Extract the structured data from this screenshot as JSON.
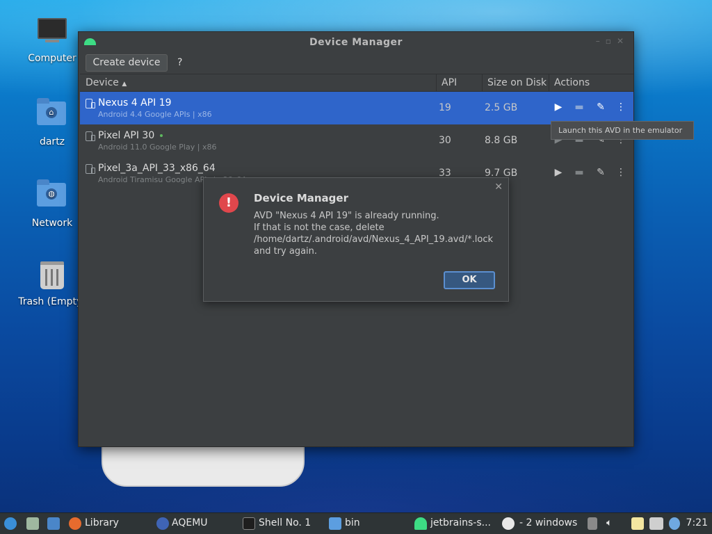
{
  "desktop": {
    "icons": [
      {
        "label": "Computer"
      },
      {
        "label": "dartz"
      },
      {
        "label": "Network"
      },
      {
        "label": "Trash (Empty)"
      }
    ]
  },
  "window": {
    "title": "Device Manager",
    "toolbar": {
      "create_label": "Create device",
      "help_label": "?"
    },
    "table": {
      "headers": {
        "device": "Device",
        "sort_arrow": "▲",
        "api": "API",
        "size": "Size on Disk",
        "actions": "Actions"
      },
      "rows": [
        {
          "name": "Nexus 4 API 19",
          "sub": "Android 4.4 Google APIs | x86",
          "api": "19",
          "size": "2.5 GB"
        },
        {
          "name": "Pixel API 30",
          "sub": "Android 11.0 Google Play | x86",
          "api": "30",
          "size": "8.8 GB"
        },
        {
          "name": "Pixel_3a_API_33_x86_64",
          "sub": "Android Tiramisu Google APIs | x86_64",
          "api": "33",
          "size": "9.7 GB"
        }
      ]
    },
    "tooltip": "Launch this AVD in the emulator"
  },
  "dialog": {
    "title": "Device Manager",
    "message": "AVD \"Nexus 4 API 19\" is already running.\nIf that is not the case, delete\n/home/dartz/.android/avd/Nexus_4_API_19.avd/*.lock\nand try again.",
    "ok_label": "OK",
    "close_glyph": "✕"
  },
  "taskbar": {
    "items": [
      {
        "label": "Library"
      },
      {
        "label": "AQEMU"
      },
      {
        "label": "Shell No. 1"
      },
      {
        "label": "bin"
      },
      {
        "label": "jetbrains-s..."
      },
      {
        "label": "- 2 windows"
      }
    ],
    "clock": "7:21"
  },
  "colors": {
    "selection": "#2f65ca",
    "error": "#e0474c",
    "android_green": "#3ddc84"
  }
}
